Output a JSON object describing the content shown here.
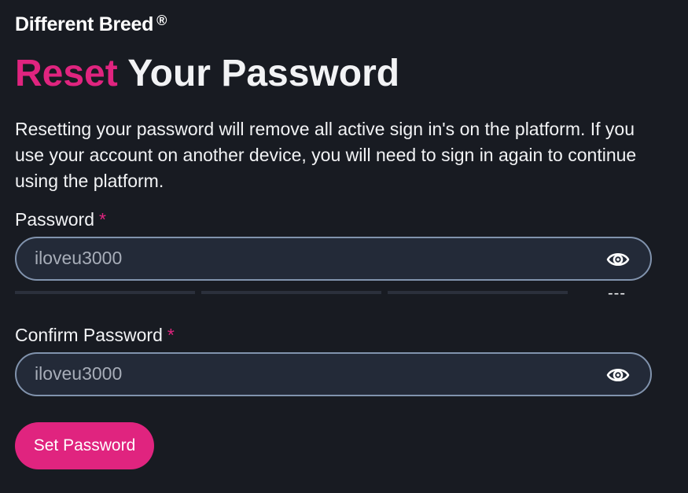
{
  "brand": {
    "name": "Different Breed",
    "registered": "®"
  },
  "heading": {
    "accent": "Reset",
    "rest": "Your Password"
  },
  "description": "Resetting your password will remove all active sign in's on the platform. If you use your account on another device, you will need to sign in again to continue using the platform.",
  "password": {
    "label": "Password",
    "required_marker": "*",
    "value": "iloveu3000",
    "toggle_icon": "eye-icon",
    "strength_text": "---"
  },
  "confirm_password": {
    "label": "Confirm Password",
    "required_marker": "*",
    "value": "iloveu3000",
    "toggle_icon": "eye-icon"
  },
  "submit": {
    "label": "Set Password"
  },
  "colors": {
    "background": "#181b22",
    "accent": "#e0247f",
    "input_background": "#232a38",
    "input_border": "#8193ad"
  }
}
